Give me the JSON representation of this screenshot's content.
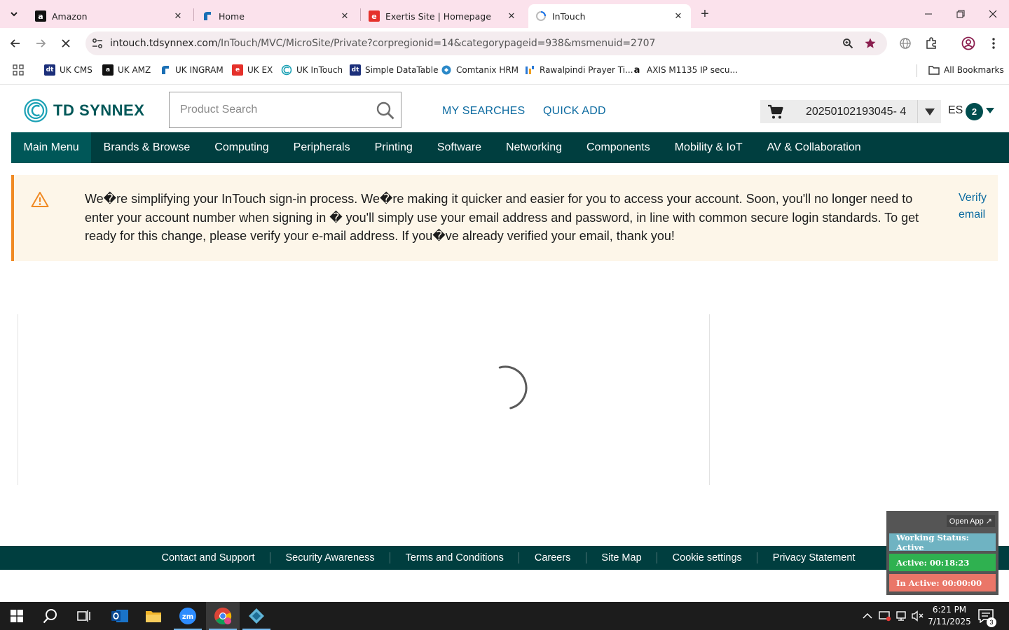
{
  "browser": {
    "tabs": [
      {
        "title": "Amazon",
        "favicon": "amazon-icon"
      },
      {
        "title": "Home",
        "favicon": "ingram-icon"
      },
      {
        "title": "Exertis Site | Homepage",
        "favicon": "exertis-icon"
      },
      {
        "title": "InTouch",
        "favicon": "loading-icon",
        "active": true
      }
    ],
    "url_host": "intouch.tdsynnex.com",
    "url_path": "/InTouch/MVC/MicroSite/Private?corpregionid=14&categorypageid=938&msmenuid=2707",
    "bookmarks": [
      {
        "label": "UK CMS",
        "icon": "dt-icon"
      },
      {
        "label": "UK AMZ",
        "icon": "amazon-icon"
      },
      {
        "label": "UK INGRAM",
        "icon": "ingram-icon"
      },
      {
        "label": "UK EX",
        "icon": "exertis-icon"
      },
      {
        "label": "UK InTouch",
        "icon": "intouch-icon"
      },
      {
        "label": "Simple DataTable",
        "icon": "dt-icon"
      },
      {
        "label": "Comtanix HRM",
        "icon": "comtanix-icon"
      },
      {
        "label": "Rawalpindi Prayer Ti...",
        "icon": "prayer-icon"
      },
      {
        "label": "AXIS M1135 IP secu...",
        "icon": "amazon-icon"
      }
    ],
    "all_bookmarks": "All Bookmarks"
  },
  "header": {
    "logo_text": "TD SYNNEX",
    "search_placeholder": "Product Search",
    "my_searches": "MY SEARCHES",
    "quick_add": "QUICK ADD",
    "cart_number": "20250102193045- 4",
    "language": "ES",
    "badge_count": "2"
  },
  "nav": {
    "items": [
      "Main Menu",
      "Brands & Browse",
      "Computing",
      "Peripherals",
      "Printing",
      "Software",
      "Networking",
      "Components",
      "Mobility & IoT",
      "AV & Collaboration"
    ]
  },
  "notice": {
    "message": "We�re simplifying your InTouch sign-in process. We�re making it quicker and easier for you to access your account. Soon, you'll no longer need to enter your account number when signing in � you'll simply use your email address and password, in line with common secure login standards. To get ready for this change, please verify your e-mail address. If you�ve already verified your email, thank you!",
    "verify_link": "Verify email"
  },
  "footer": {
    "links": [
      "Contact and Support",
      "Security Awareness",
      "Terms and Conditions",
      "Careers",
      "Site Map",
      "Cookie settings",
      "Privacy Statement"
    ]
  },
  "status_widget": {
    "open_app": "Open App ↗",
    "working": "Working Status: Active",
    "active": "Active: 00:18:23",
    "inactive": "In Active: 00:00:00",
    "colors": {
      "working": "#6fb3c2",
      "active": "#2fb150",
      "inactive": "#ea7668"
    }
  },
  "taskbar": {
    "time": "6:21 PM",
    "date": "7/11/2025",
    "notification_count": "3"
  },
  "colors": {
    "brand_dark": "#003e3f",
    "brand": "#005758",
    "link": "#0b6aa0",
    "warning": "#f08a24"
  }
}
